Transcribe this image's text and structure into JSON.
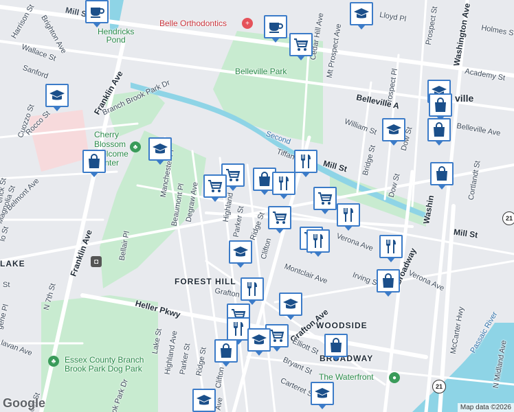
{
  "labels": {
    "mill_st_top": "Mill St",
    "harrison_st": "Harrison St",
    "brighton_ave": "Brighton Ave",
    "wallace_st": "Wallace St",
    "sanford": "Sanford",
    "franklin_ave_top": "Franklin Ave",
    "branch_brook_park_dr": "Branch Brook Park Dr",
    "cuozzo_st": "Cuozzo St",
    "rocco_st": "Rocco St",
    "hendricks_pond": "Hendricks\nPond",
    "belle_orthodontics": "Belle Orthodontics",
    "belleville_park": "Belleville Park",
    "cherry_blossom": "Cherry\nBlossom\nWelcome\nCenter",
    "manchester_pl": "Manchester Pl",
    "beaumont_pl": "Beaumont Pl",
    "degraw_ave": "Degraw Ave",
    "highland_ave_top": "Highland",
    "parker_st_top": "Parker St",
    "ridge_st_top": "Ridge St",
    "clifton_top": "Clifton",
    "magnolia_st": "Magnolia St",
    "belmont_ave": "Belmont Ave",
    "erick_st": "erick St",
    "franklin_ave_mid": "Franklin Ave",
    "bellair_pl": "Bellair Pl",
    "lake": "LAKE",
    "forest_hill": "FOREST HILL",
    "grafton_top": "Grafton Av",
    "montclair_ave": "Montclair Ave",
    "irving_st": "Irving St",
    "verona_ave_left": "Verona Ave",
    "verona_ave_right": "Verona Ave",
    "mill_st_right": "Mill St",
    "mill_st_mid": "Mill St",
    "second_river": "Second",
    "tiffany": "Tiffan",
    "william_st": "William St",
    "bridge_st": "Bridge St",
    "dow_st": "Dow St",
    "dow_st2": "Dow St",
    "prospect_pl": "Prospect Pl",
    "prospect_st": "Prospect St",
    "washington_ave": "Washington Ave",
    "washington_ave2": "Washin",
    "cortlandt_st": "Cortlandt St",
    "belleville_ave": "Belleville Ave",
    "belleville_ave2": "Belleville A",
    "belleville_town": "ville",
    "academy_st": "Academy St",
    "holmes_st": "Holmes St",
    "lloyd_pl": "Lloyd Pl",
    "cedar_hill_ave": "Cedar Hill Ave",
    "mt_prospect_ave": "Mt Prospect Ave",
    "n7th_st": "N 7th St",
    "heller_pkwy": "Heller Pkwy",
    "lake_st": "Lake St",
    "highland_ave_bot": "Highland Ave",
    "parker_st_bot": "Parker St",
    "ridge_st_bot": "Ridge St",
    "clifton_bot": "Clifton",
    "grafton_ave": "Grafton Ave",
    "elliott_st": "Elliott St",
    "bryant_st": "Bryant St",
    "carteret_st": "Carteret St",
    "woodside": "WOODSIDE",
    "broadway_area": "BROADWAY",
    "broadway_road": "Broadway",
    "the_waterfront": "The Waterfront",
    "essex_park": "Essex County Branch\nBrook Park Dog Park",
    "mccarter_hwy": "McCarter Hwy",
    "passaic_river": "Passaic River",
    "n_midland_ave": "N Midland Ave",
    "ave_bottom": "Ave",
    "gene_pl": "gene Pl",
    "avalon_ave": "lavan Ave",
    "ok_park": "ok Park Dr",
    "th_st": "6th St",
    "st_partial": "St",
    "lo_st": "lo St",
    "route_21a": "21",
    "route_21b": "21"
  },
  "footer": {
    "google_logo": "Google",
    "credit": "Map data ©2026"
  },
  "markers": [
    {
      "icon": "coffee-icon"
    },
    {
      "icon": "coffee-icon"
    },
    {
      "icon": "cart-icon"
    },
    {
      "icon": "school-icon"
    },
    {
      "icon": "school-icon"
    },
    {
      "icon": "school-icon"
    },
    {
      "icon": "shopping-bag-icon"
    },
    {
      "icon": "school-icon"
    },
    {
      "icon": "shopping-bag-icon"
    },
    {
      "icon": "school-icon"
    },
    {
      "icon": "shopping-bag-icon"
    },
    {
      "icon": "shopping-bag-icon"
    },
    {
      "icon": "cart-icon"
    },
    {
      "icon": "cart-icon"
    },
    {
      "icon": "shopping-bag-icon"
    },
    {
      "icon": "restaurant-icon"
    },
    {
      "icon": "restaurant-icon"
    },
    {
      "icon": "cart-icon"
    },
    {
      "icon": "cart-icon"
    },
    {
      "icon": "restaurant-icon"
    },
    {
      "icon": "cart-icon"
    },
    {
      "icon": "restaurant-icon"
    },
    {
      "icon": "restaurant-icon"
    },
    {
      "icon": "shopping-bag-icon"
    },
    {
      "icon": "school-icon"
    },
    {
      "icon": "restaurant-icon"
    },
    {
      "icon": "school-icon"
    },
    {
      "icon": "cart-icon"
    },
    {
      "icon": "restaurant-icon"
    },
    {
      "icon": "cart-icon"
    },
    {
      "icon": "school-icon"
    },
    {
      "icon": "shopping-bag-icon"
    },
    {
      "icon": "shopping-bag-icon"
    },
    {
      "icon": "school-icon"
    },
    {
      "icon": "school-icon"
    }
  ],
  "colors": {
    "park": "#c8ebd0",
    "water": "#8ed4e6",
    "road": "#ffffff",
    "marker_border": "#3b7bc8",
    "icon": "#1b4f8a"
  }
}
